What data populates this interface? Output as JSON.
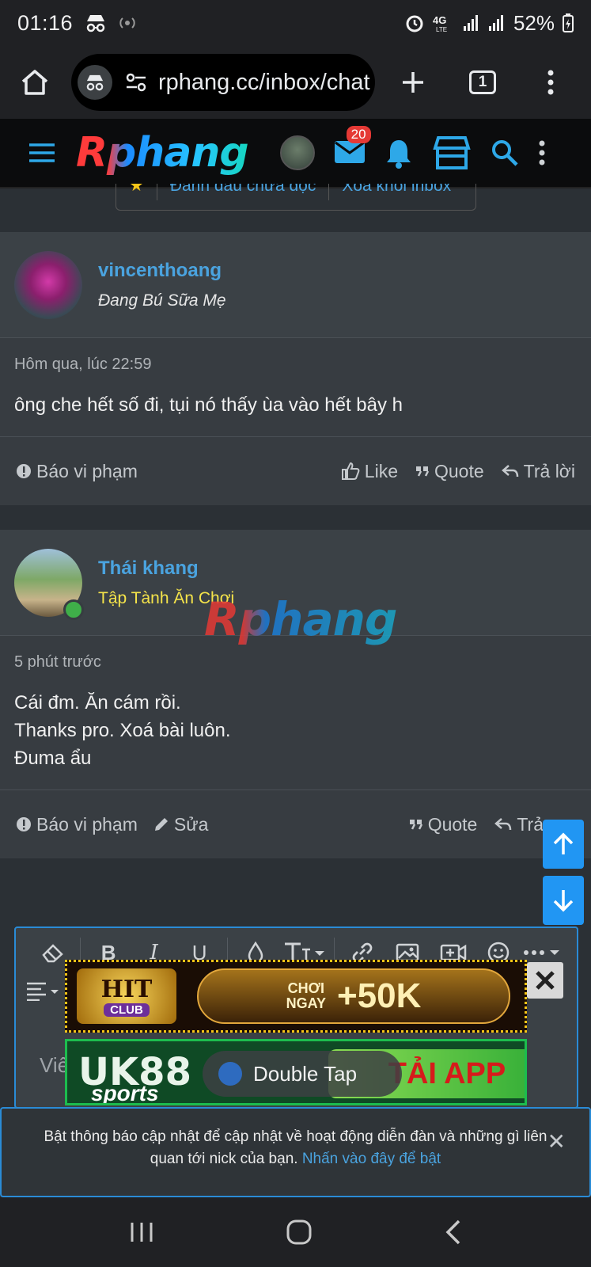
{
  "status": {
    "time": "01:16",
    "battery": "52%",
    "network": "4G"
  },
  "browser": {
    "url": "rphang.cc/inbox/chat",
    "tab_count": "1"
  },
  "site": {
    "logo": "Rphang",
    "mail_badge": "20"
  },
  "conversation_actions": {
    "mark_unread": "Đánh dấu chưa đọc",
    "remove": "Xoá khỏi inbox"
  },
  "posts": [
    {
      "username": "vincenthoang",
      "user_title": "Đang Bú Sữa Mẹ",
      "time": "Hôm qua, lúc 22:59",
      "lines": [
        "ông che hết số đi, tụi nó thấy ùa vào hết bây h"
      ],
      "report": "Báo vi phạm",
      "like": "Like",
      "quote": "Quote",
      "reply": "Trả lời"
    },
    {
      "username": "Thái khang",
      "user_title": "Tập Tành Ăn Chơi",
      "time": "5 phút trước",
      "lines": [
        "Cái đm. Ăn cám rồi.",
        "Thanks pro. Xoá bài luôn.",
        "Đuma ẩu"
      ],
      "report": "Báo vi phạm",
      "edit": "Sửa",
      "quote": "Quote",
      "reply": "Trả"
    }
  ],
  "watermark": "Rphang",
  "editor": {
    "placeholder": "Viế"
  },
  "ads": {
    "hit_logo": "HIT",
    "hit_sub": "CLUB",
    "hit_cta_small": "CHƠI\nNGAY",
    "hit_cta_amount": "+50K",
    "uk_logo": "UK88",
    "uk_sub": "sports",
    "uk_cta": "TẢI APP"
  },
  "toast": {
    "label": "Double Tap"
  },
  "notification": {
    "text": "Bật thông báo cập nhật để cập nhật về hoạt động diễn đàn và những gì liên quan tới nick của bạn.",
    "link": "Nhấn vào đây để bật"
  },
  "colors": {
    "accent": "#4aa3df",
    "title_yellow": "#f5e44a",
    "scroll_btn": "#2196f3"
  }
}
